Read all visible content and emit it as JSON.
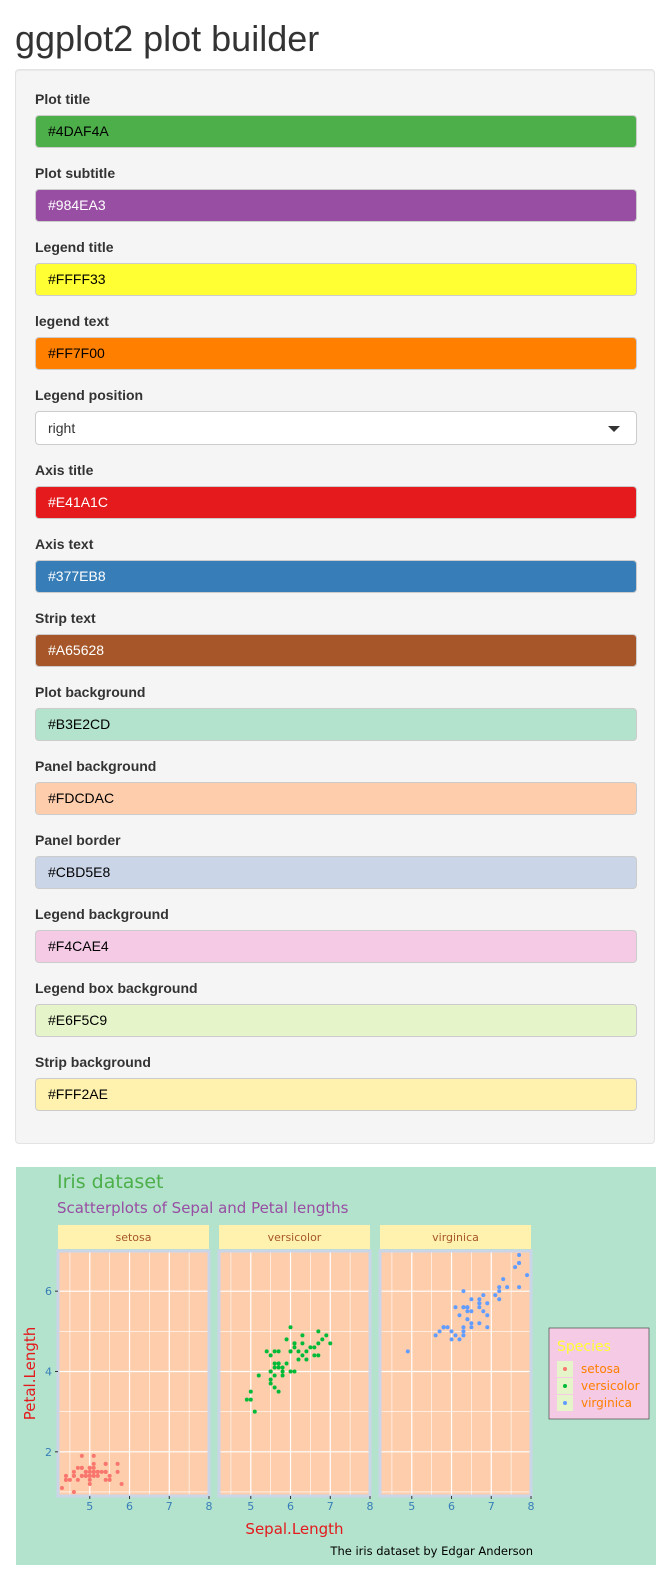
{
  "page_title": "ggplot2 plot builder",
  "fields": [
    {
      "label": "Plot title",
      "value": "#4DAF4A",
      "fg": "#000000"
    },
    {
      "label": "Plot subtitle",
      "value": "#984EA3",
      "fg": "#ffffff"
    },
    {
      "label": "Legend title",
      "value": "#FFFF33",
      "fg": "#000000"
    },
    {
      "label": "legend text",
      "value": "#FF7F00",
      "fg": "#000000"
    },
    {
      "label": "Legend position",
      "value": "right",
      "type": "select"
    },
    {
      "label": "Axis title",
      "value": "#E41A1C",
      "fg": "#ffffff"
    },
    {
      "label": "Axis text",
      "value": "#377EB8",
      "fg": "#ffffff"
    },
    {
      "label": "Strip text",
      "value": "#A65628",
      "fg": "#ffffff"
    },
    {
      "label": "Plot background",
      "value": "#B3E2CD",
      "fg": "#000000"
    },
    {
      "label": "Panel background",
      "value": "#FDCDAC",
      "fg": "#000000"
    },
    {
      "label": "Panel border",
      "value": "#CBD5E8",
      "fg": "#000000"
    },
    {
      "label": "Legend background",
      "value": "#F4CAE4",
      "fg": "#000000"
    },
    {
      "label": "Legend box background",
      "value": "#E6F5C9",
      "fg": "#000000"
    },
    {
      "label": "Strip background",
      "value": "#FFF2AE",
      "fg": "#000000"
    }
  ],
  "chart_data": {
    "type": "scatter",
    "title": "Iris dataset",
    "subtitle": "Scatterplots of Sepal and Petal lengths",
    "caption": "The iris dataset by Edgar Anderson",
    "xlabel": "Sepal.Length",
    "ylabel": "Petal.Length",
    "xlim": [
      4.2,
      8.0
    ],
    "ylim": [
      0.9,
      7.0
    ],
    "x_ticks": [
      5,
      6,
      7,
      8
    ],
    "y_ticks": [
      2,
      4,
      6
    ],
    "facets": [
      "setosa",
      "versicolor",
      "virginica"
    ],
    "legend_title": "Species",
    "legend_position": "right",
    "series": [
      {
        "name": "setosa",
        "color": "#F8766D",
        "x": [
          5.1,
          4.9,
          4.7,
          4.6,
          5.0,
          5.4,
          4.6,
          5.0,
          4.4,
          4.9,
          5.4,
          4.8,
          4.8,
          4.3,
          5.8,
          5.7,
          5.4,
          5.1,
          5.7,
          5.1,
          5.4,
          5.1,
          4.6,
          5.1,
          4.8,
          5.0,
          5.0,
          5.2,
          5.2,
          4.7,
          4.8,
          5.4,
          5.2,
          5.5,
          4.9,
          5.0,
          5.5,
          4.9,
          4.4,
          5.1,
          5.0,
          4.5,
          4.4,
          5.0,
          5.1,
          4.8,
          5.1,
          4.6,
          5.3,
          5.0
        ],
        "y": [
          1.4,
          1.4,
          1.3,
          1.5,
          1.4,
          1.7,
          1.4,
          1.5,
          1.4,
          1.5,
          1.5,
          1.6,
          1.4,
          1.1,
          1.2,
          1.5,
          1.3,
          1.4,
          1.7,
          1.5,
          1.7,
          1.5,
          1.0,
          1.7,
          1.9,
          1.6,
          1.6,
          1.5,
          1.4,
          1.6,
          1.6,
          1.5,
          1.5,
          1.4,
          1.5,
          1.2,
          1.3,
          1.4,
          1.3,
          1.5,
          1.3,
          1.3,
          1.3,
          1.6,
          1.9,
          1.4,
          1.6,
          1.4,
          1.5,
          1.4
        ]
      },
      {
        "name": "versicolor",
        "color": "#00BA38",
        "x": [
          7.0,
          6.4,
          6.9,
          5.5,
          6.5,
          5.7,
          6.3,
          4.9,
          6.6,
          5.2,
          5.0,
          5.9,
          6.0,
          6.1,
          5.6,
          6.7,
          5.6,
          5.8,
          6.2,
          5.6,
          5.9,
          6.1,
          6.3,
          6.1,
          6.4,
          6.6,
          6.8,
          6.7,
          6.0,
          5.7,
          5.5,
          5.5,
          5.8,
          6.0,
          5.4,
          6.0,
          6.7,
          6.3,
          5.6,
          5.5,
          5.5,
          6.1,
          5.8,
          5.0,
          5.6,
          5.7,
          5.7,
          6.2,
          5.1,
          5.7
        ],
        "y": [
          4.7,
          4.5,
          4.9,
          4.0,
          4.6,
          4.5,
          4.7,
          3.3,
          4.6,
          3.9,
          3.5,
          4.2,
          4.0,
          4.7,
          3.6,
          4.4,
          4.5,
          4.1,
          4.5,
          3.9,
          4.8,
          4.0,
          4.9,
          4.7,
          4.3,
          4.4,
          4.8,
          5.0,
          4.5,
          3.5,
          3.8,
          3.7,
          3.9,
          5.1,
          4.5,
          4.5,
          4.7,
          4.4,
          4.1,
          4.0,
          4.4,
          4.6,
          4.0,
          3.3,
          4.2,
          4.2,
          4.2,
          4.3,
          3.0,
          4.1
        ]
      },
      {
        "name": "virginica",
        "color": "#619CFF",
        "x": [
          6.3,
          5.8,
          7.1,
          6.3,
          6.5,
          7.6,
          4.9,
          7.3,
          6.7,
          7.2,
          6.5,
          6.4,
          6.8,
          5.7,
          5.8,
          6.4,
          6.5,
          7.7,
          7.7,
          6.0,
          6.9,
          5.6,
          7.7,
          6.3,
          6.7,
          7.2,
          6.2,
          6.1,
          6.4,
          7.2,
          7.4,
          7.9,
          6.4,
          6.3,
          6.1,
          7.7,
          6.3,
          6.4,
          6.0,
          6.9,
          6.7,
          6.9,
          5.8,
          6.8,
          6.7,
          6.7,
          6.3,
          6.5,
          6.2,
          5.9
        ],
        "y": [
          6.0,
          5.1,
          5.9,
          5.6,
          5.8,
          6.6,
          4.5,
          6.3,
          5.8,
          6.1,
          5.1,
          5.3,
          5.5,
          5.0,
          5.1,
          5.3,
          5.5,
          6.7,
          6.9,
          5.0,
          5.7,
          4.9,
          6.7,
          4.9,
          5.7,
          6.0,
          4.8,
          4.9,
          5.6,
          5.8,
          6.1,
          6.4,
          5.6,
          5.1,
          5.6,
          6.1,
          5.6,
          5.5,
          4.8,
          5.4,
          5.6,
          5.1,
          5.1,
          5.9,
          5.7,
          5.2,
          5.0,
          5.2,
          5.4,
          5.1
        ]
      }
    ],
    "colors": {
      "plot_title": "#4DAF4A",
      "plot_subtitle": "#984EA3",
      "legend_title": "#FFFF33",
      "legend_text": "#FF7F00",
      "axis_title": "#E41A1C",
      "axis_text": "#377EB8",
      "strip_text": "#A65628",
      "plot_background": "#B3E2CD",
      "panel_background": "#FDCDAC",
      "panel_border": "#CBD5E8",
      "legend_background": "#F4CAE4",
      "legend_box_background": "#E6F5C9",
      "strip_background": "#FFF2AE",
      "grid": "#ffffff"
    }
  }
}
